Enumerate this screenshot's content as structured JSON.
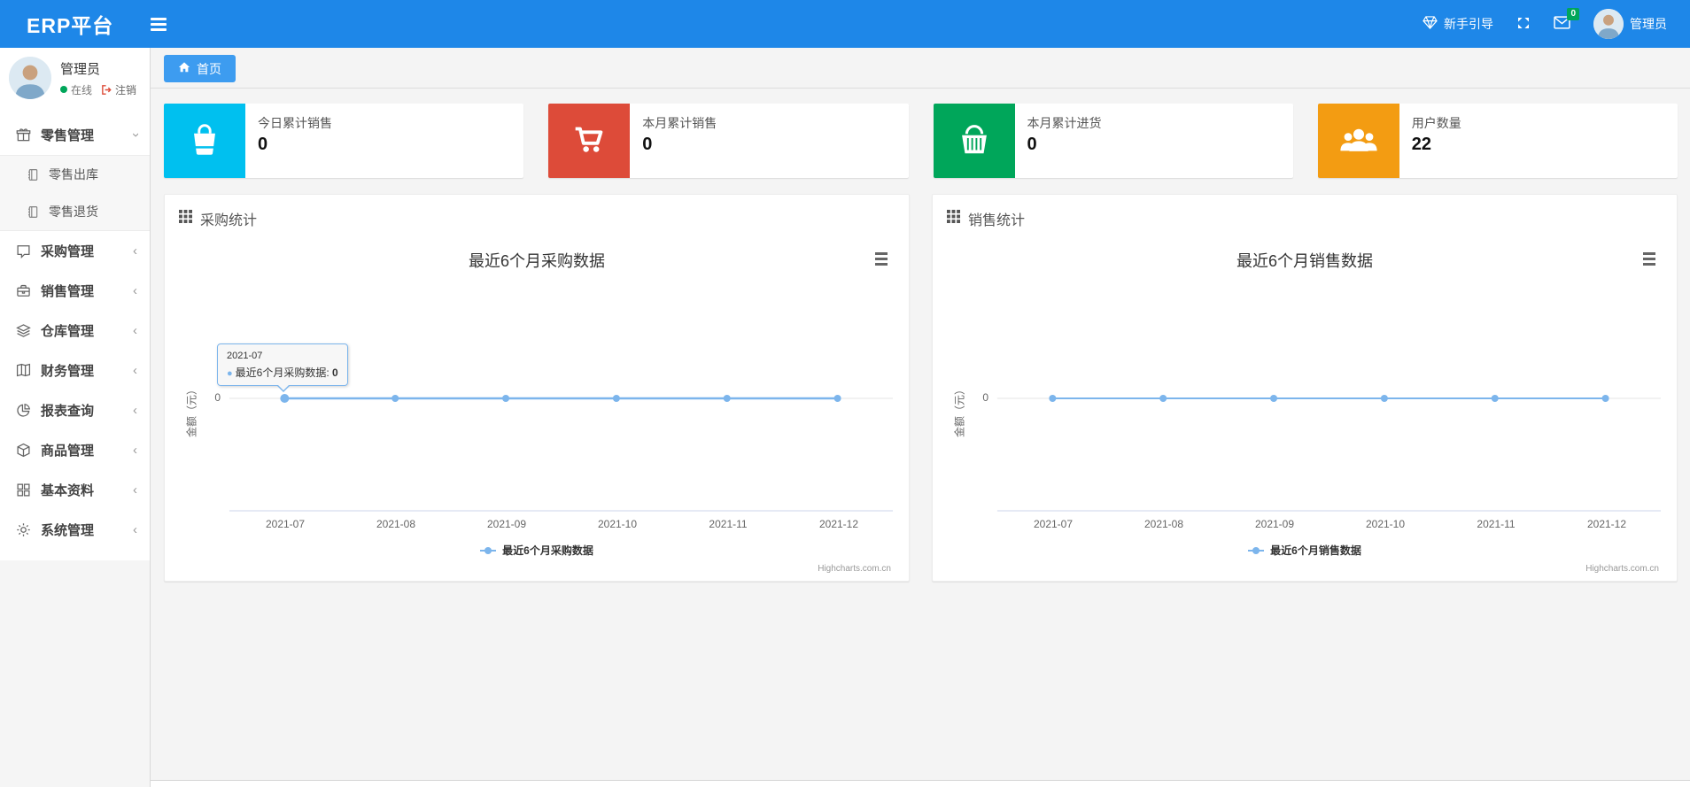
{
  "theme": {
    "navbar_bg": "#1e87e8",
    "tab_active_bg": "#3d9cf0",
    "badge_bg": "#00a65a",
    "content_bg": "#f4f4f4"
  },
  "navbar": {
    "brand": "ERP平台",
    "guide_label": "新手引导",
    "mail_badge": "0",
    "username": "管理员"
  },
  "sidebar": {
    "user": {
      "name": "管理员",
      "status": "在线",
      "logout_label": "注销"
    },
    "menu": [
      {
        "label": "零售管理",
        "icon": "gift",
        "expanded": true,
        "children": [
          {
            "label": "零售出库",
            "icon": "journal"
          },
          {
            "label": "零售退货",
            "icon": "journal"
          }
        ]
      },
      {
        "label": "采购管理",
        "icon": "chat"
      },
      {
        "label": "销售管理",
        "icon": "briefcase"
      },
      {
        "label": "仓库管理",
        "icon": "layers"
      },
      {
        "label": "财务管理",
        "icon": "book"
      },
      {
        "label": "报表查询",
        "icon": "pie-chart"
      },
      {
        "label": "商品管理",
        "icon": "cube"
      },
      {
        "label": "基本资料",
        "icon": "grid"
      },
      {
        "label": "系统管理",
        "icon": "gear"
      }
    ]
  },
  "tabs": [
    {
      "label": "首页",
      "active": true
    }
  ],
  "stat_cards": [
    {
      "label": "今日累计销售",
      "value": "0",
      "color": "#00c0ef",
      "icon": "shopping-bag"
    },
    {
      "label": "本月累计销售",
      "value": "0",
      "color": "#dd4b39",
      "icon": "shopping-cart"
    },
    {
      "label": "本月累计进货",
      "value": "0",
      "color": "#00a65a",
      "icon": "shopping-basket"
    },
    {
      "label": "用户数量",
      "value": "22",
      "color": "#f39c12",
      "icon": "users"
    }
  ],
  "panels": [
    {
      "title": "采购统计"
    },
    {
      "title": "销售统计"
    }
  ],
  "chart_data": [
    {
      "type": "line",
      "title": "最近6个月采购数据",
      "ylabel": "金额（元）",
      "categories": [
        "2021-07",
        "2021-08",
        "2021-09",
        "2021-10",
        "2021-11",
        "2021-12"
      ],
      "series": [
        {
          "name": "最近6个月采购数据",
          "values": [
            0,
            0,
            0,
            0,
            0,
            0
          ],
          "color": "#7cb5ec"
        }
      ],
      "yticks": [
        "0"
      ],
      "legend_position": "bottom-center",
      "grid": true,
      "tooltip": {
        "header": "2021-07",
        "label": "最近6个月采购数据: ",
        "value": "0"
      }
    },
    {
      "type": "line",
      "title": "最近6个月销售数据",
      "ylabel": "金额（元）",
      "categories": [
        "2021-07",
        "2021-08",
        "2021-09",
        "2021-10",
        "2021-11",
        "2021-12"
      ],
      "series": [
        {
          "name": "最近6个月销售数据",
          "values": [
            0,
            0,
            0,
            0,
            0,
            0
          ],
          "color": "#7cb5ec"
        }
      ],
      "yticks": [
        "0"
      ],
      "legend_position": "bottom-center",
      "grid": true
    }
  ],
  "credits": "Highcharts.com.cn"
}
